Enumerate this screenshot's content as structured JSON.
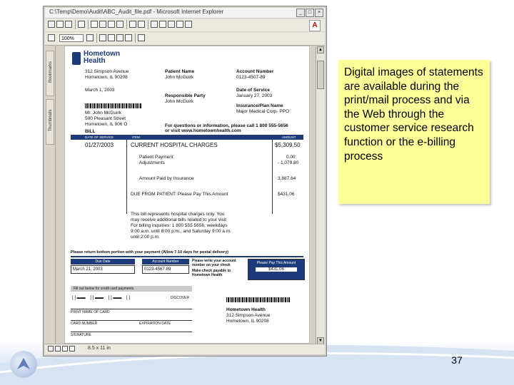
{
  "window": {
    "title": "C:\\Temp\\Demo\\Audit\\ABC_Audit_file.pdf - Microsoft Internet Explorer",
    "zoom": "100%",
    "status": "8.5 x 11 in",
    "side_tabs": [
      "Bookmarks",
      "Thumbnails"
    ]
  },
  "document": {
    "org_name_line1": "Hometown",
    "org_name_line2": "Health",
    "org_address1": "312 Simpson Avenue",
    "org_address2": "Hometown, IL 90208",
    "statement_date": "March 1, 2003",
    "patient_name_label": "Patient Name",
    "patient_name": "John McGuirk",
    "account_number_label": "Account Number",
    "account_number": "0123-4507-89",
    "responsible_party_label": "Responsible Party",
    "responsible_party": "John McGuirk",
    "date_of_service_label": "Date of Service",
    "date_of_service": "January 27, 2003",
    "insurance_label": "Insurance/Plan Name",
    "insurance": "Major Medical Corp- PPO",
    "addressee1": "Mr. John McGuirk",
    "addressee2": "500 Pleasant Street",
    "addressee3": "Hometown, IL 906 O",
    "questions": "For questions or information, please call 1 800 555-5656",
    "questions2": "or visit www.hometownhealth.com",
    "bill_label": "BILL",
    "col_date": "DATE OF SERVICE",
    "col_item": "ITEM",
    "col_amount": "AMOUNT",
    "row1_date": "01/27/2003",
    "row1_item": "CURRENT HOSPITAL CHARGES",
    "row1_amount": "$5,309.50",
    "row2_item1": "Patient Payment",
    "row2_item2": "Adjustments",
    "row2_amount1": "0.00",
    "row2_amount2": "- 1,079.80",
    "row3_item": "Amount Paid by Insurance",
    "row3_amount": "3,887.64",
    "row4_item": "DUE FROM PATIENT: Please Pay This Amount",
    "row4_amount": "$431.06",
    "note1": "This bill represents hospital charges only.  You",
    "note2": "may receive additional bills related to your visit",
    "note3": "For billing inquiries: 1 800 555 5656, weekdays",
    "note4": "9:00 a.m. until 8:00 p.m., and Saturday 9:00 a.m.",
    "note5": "until 2:00 p.m.",
    "return_note": "Please return bottom portion with your payment (Allow 7-10 days for postal delivery)",
    "due_date_label": "Due Date",
    "due_date": "March 21, 2003",
    "acct_label2": "Account Number",
    "acct2": "0123-4567-89",
    "write_acct": "Please write your account number on your check",
    "payable": "Make check payable to Hometown Health",
    "pay_this_label": "Please Pay This Amount",
    "pay_this_amount": "$431.06",
    "credit_card_bar": "Fill out below for credit card payments",
    "discover": "DISCOVER",
    "print_name": "PRINT NAME OF CARD",
    "card_number": "CARD NUMBER",
    "expiration": "EXPIRATION DATE",
    "signature": "SIGNATURE",
    "remit1": "Hometown Health",
    "remit2": "312 Simpson Avenue",
    "remit3": "Hometown, IL 90208"
  },
  "callout": {
    "text": "Digital images of statements are available during the print/mail process and via the Web through the customer service research function or the e-billing process"
  },
  "slide": {
    "page_number": "37"
  }
}
